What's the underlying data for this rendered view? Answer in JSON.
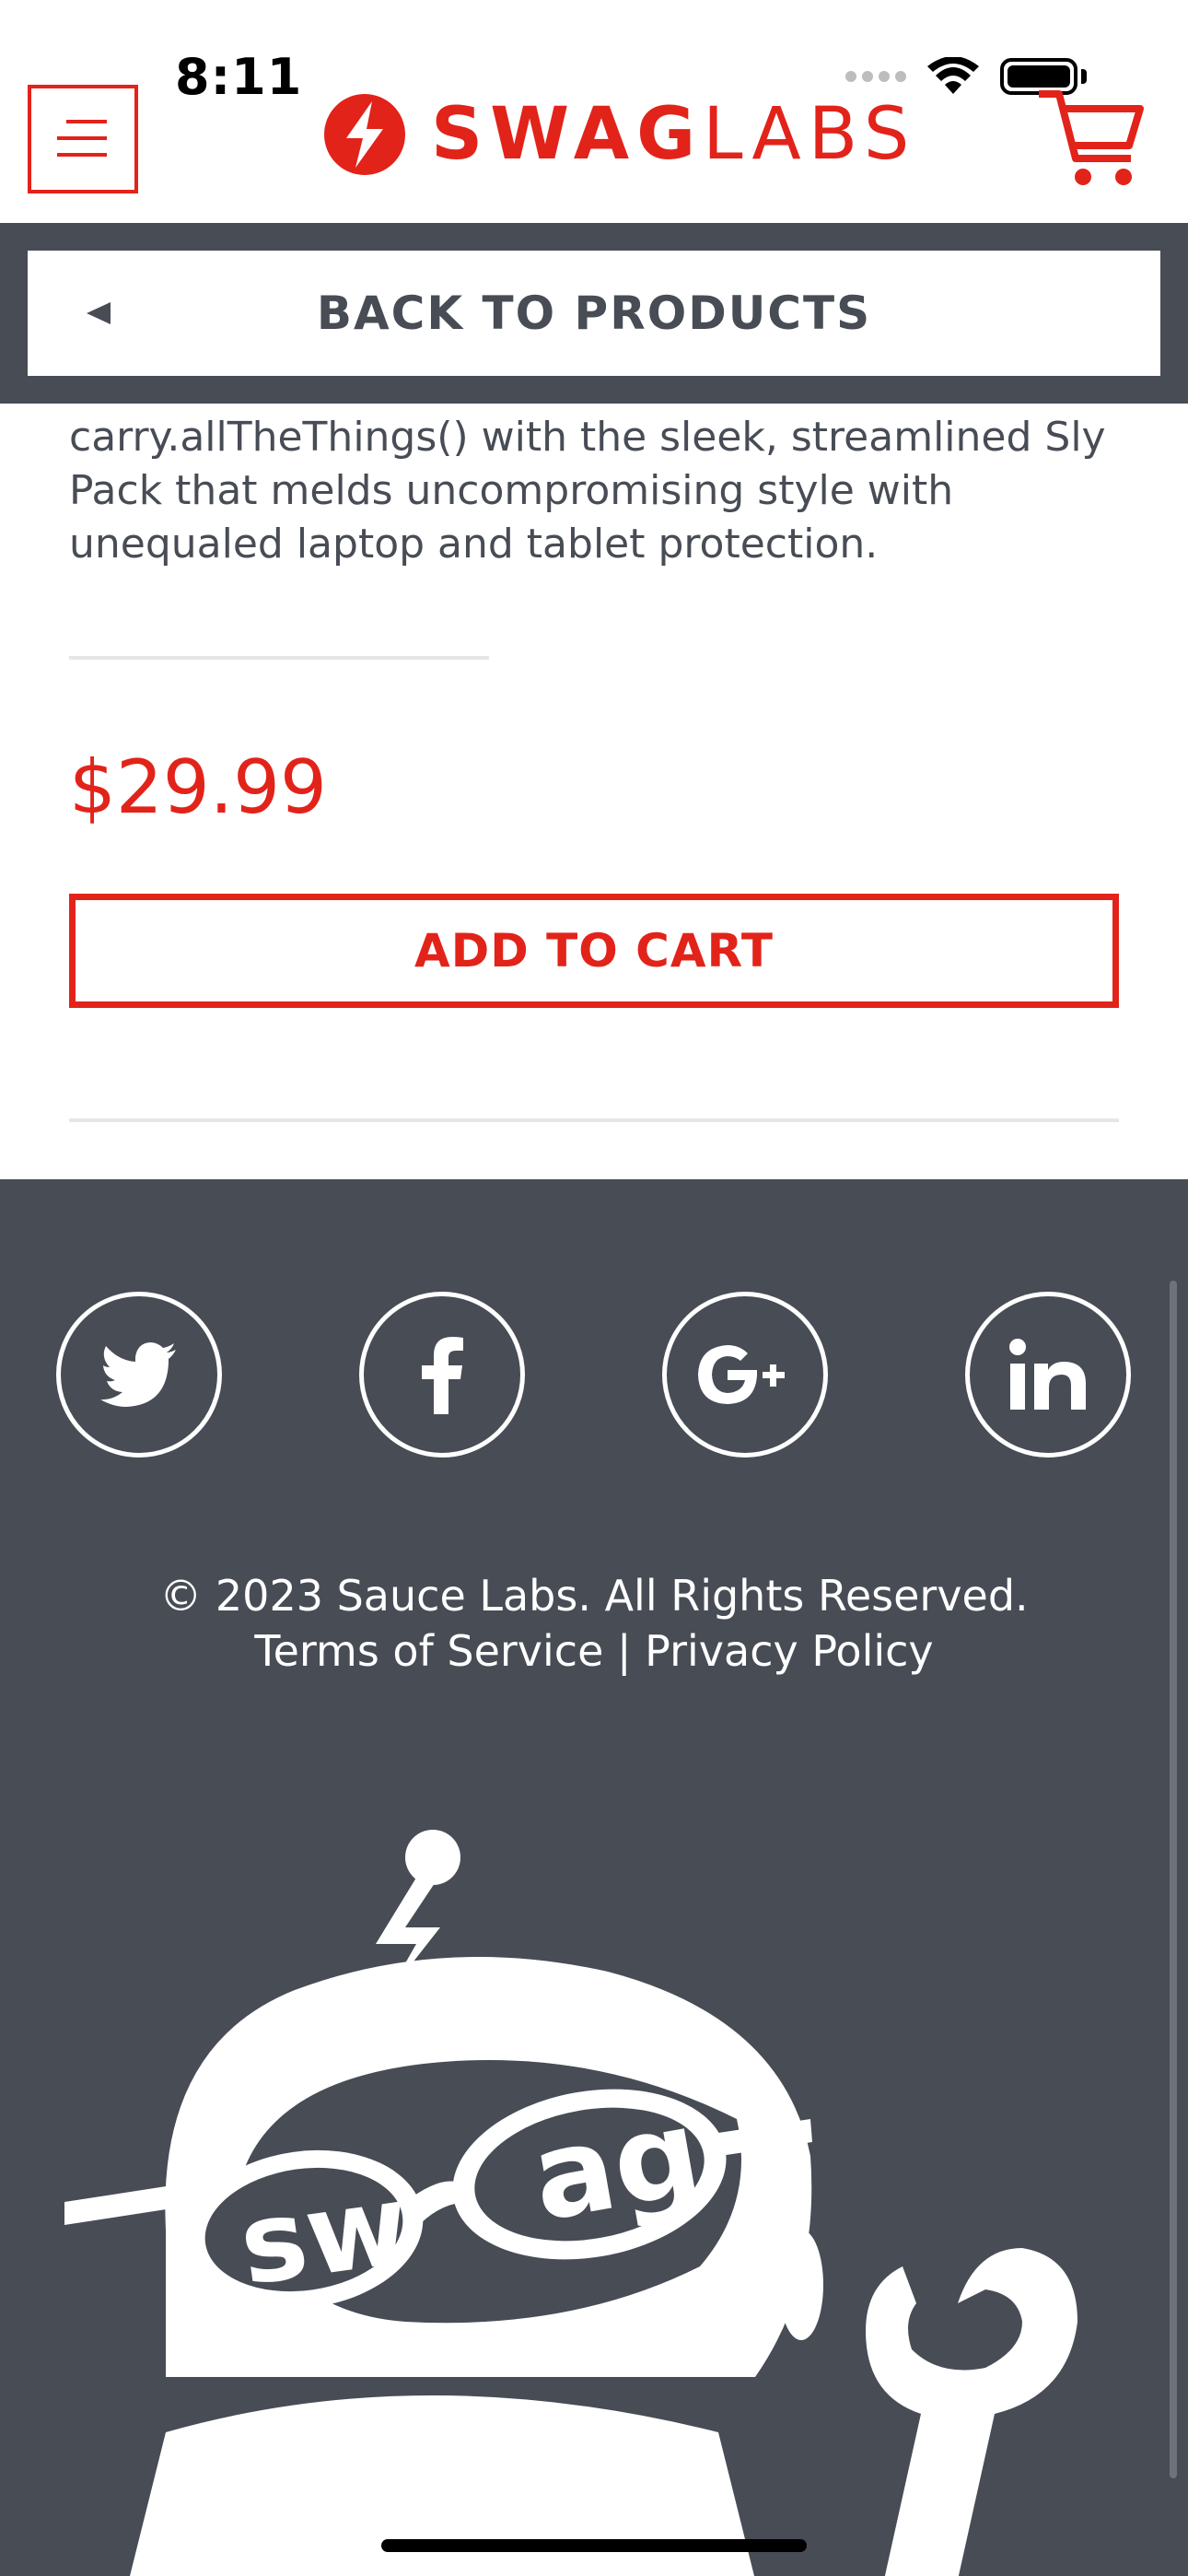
{
  "status_bar": {
    "time": "8:11"
  },
  "header": {
    "logo_part1": "SWAG",
    "logo_part2": "LABS",
    "menu_icon": "hamburger-menu-icon",
    "cart_icon": "cart-icon"
  },
  "back_button": {
    "label": "BACK TO PRODUCTS"
  },
  "product": {
    "description": "carry.allTheThings() with the sleek, streamlined Sly Pack that melds uncompromising style with unequaled laptop and tablet protection.",
    "price": "$29.99",
    "add_to_cart_label": "ADD TO CART"
  },
  "footer": {
    "social": [
      "twitter-icon",
      "facebook-icon",
      "google-plus-icon",
      "linkedin-icon"
    ],
    "copyright": "© 2023 Sauce Labs. All Rights Reserved.",
    "terms": "Terms of Service",
    "separator": "|",
    "privacy": "Privacy Policy",
    "mascot_text": "swag"
  },
  "colors": {
    "brand_red": "#e2231a",
    "dark_gray": "#474c55",
    "white": "#ffffff"
  }
}
